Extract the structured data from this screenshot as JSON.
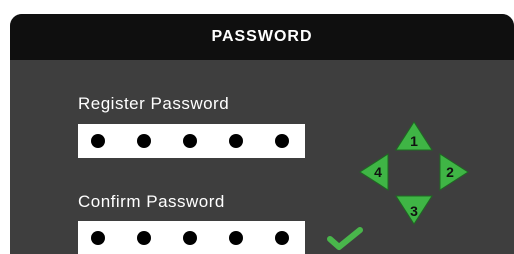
{
  "dialog": {
    "title": "PASSWORD"
  },
  "register": {
    "label": "Register Password",
    "masked_digits": 5
  },
  "confirm": {
    "label": "Confirm Password",
    "masked_digits": 5,
    "status_icon": "checkmark-icon"
  },
  "navpad": {
    "up_label": "1",
    "right_label": "2",
    "down_label": "3",
    "left_label": "4"
  },
  "colors": {
    "panel": "#3e3e3e",
    "titlebar": "#0f0f0f",
    "arrow_green": "#3fb545",
    "check_green": "#49b64b"
  }
}
